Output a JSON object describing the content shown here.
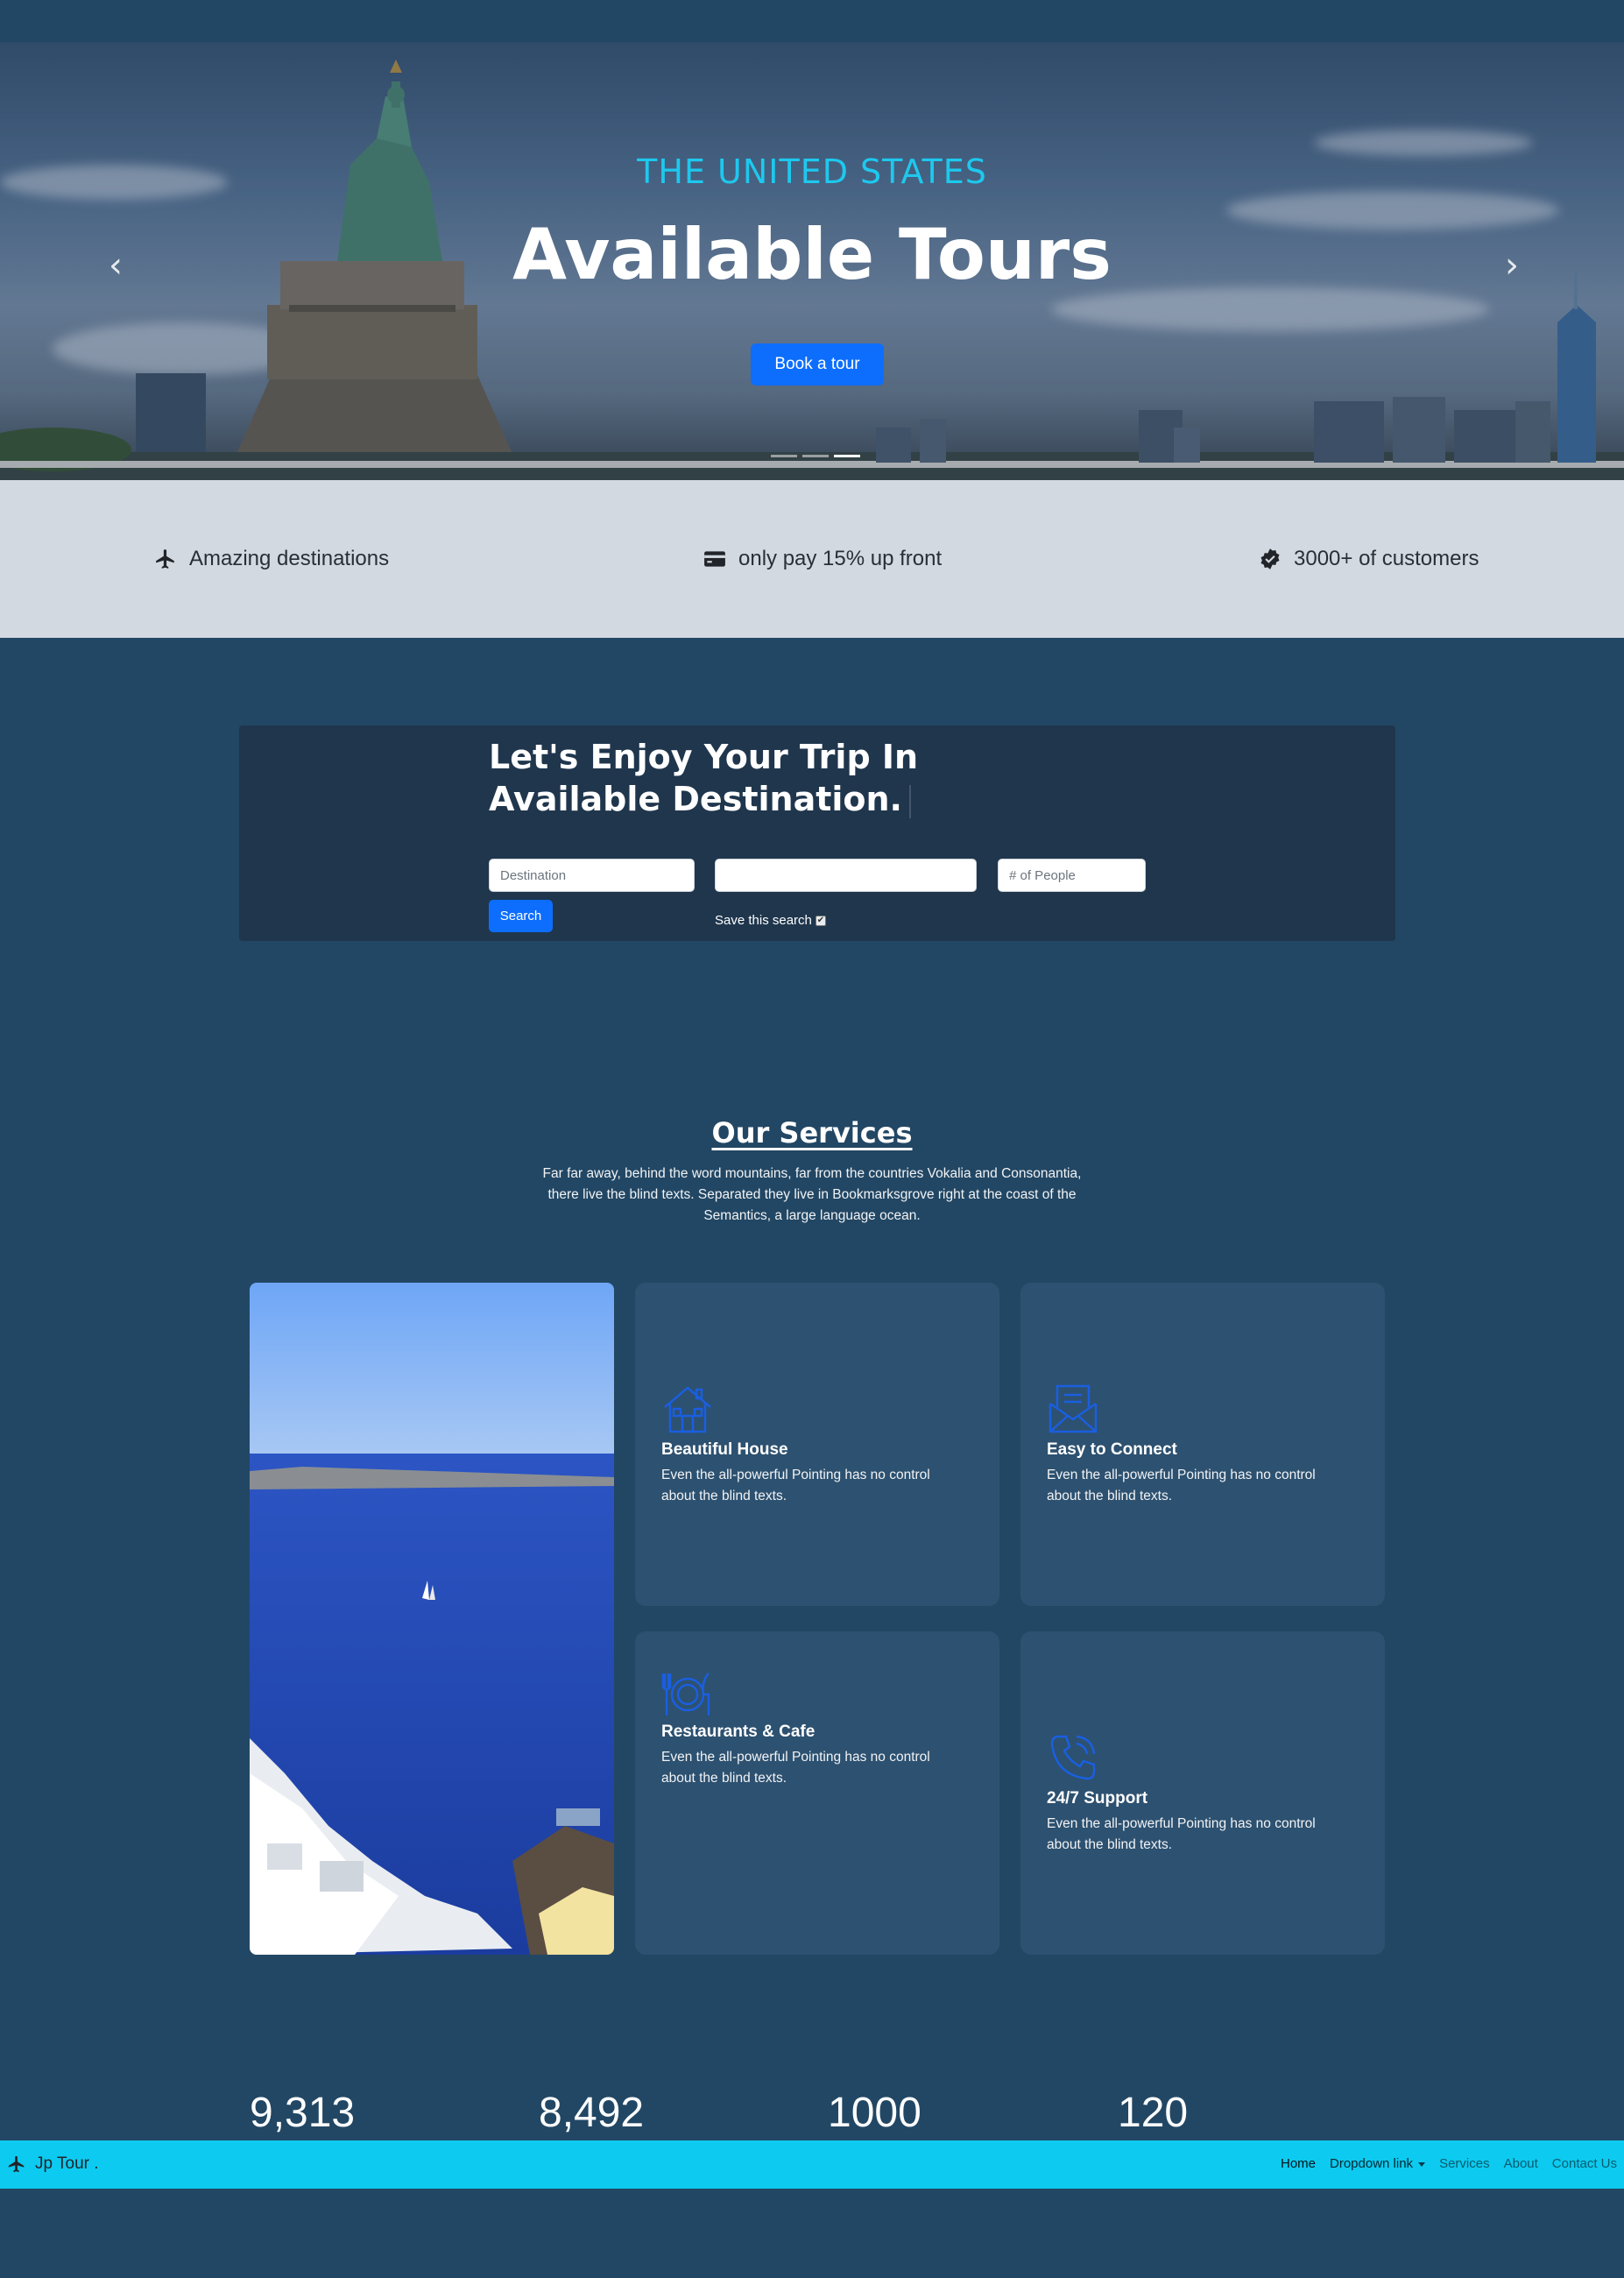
{
  "hero": {
    "subtitle": "THE UNITED STATES",
    "title": "Available Tours",
    "button_label": "Book a tour",
    "prev_icon": "chevron-left-icon",
    "next_icon": "chevron-right-icon",
    "slides": 3,
    "active_slide": 3
  },
  "features": [
    {
      "icon": "airplane-icon",
      "label": "Amazing destinations"
    },
    {
      "icon": "credit-card-icon",
      "label": "only pay 15% up front"
    },
    {
      "icon": "verified-badge-icon",
      "label": "3000+ of customers"
    }
  ],
  "search": {
    "heading_line1": "Let's Enjoy Your Trip In",
    "heading_line2": "Available Destination.",
    "destination_placeholder": "Destination",
    "date_value": "",
    "people_placeholder": "# of People",
    "search_label": "Search",
    "save_label": "Save this search",
    "save_checked": true
  },
  "services": {
    "title": "Our Services",
    "description": "Far far away, behind the word mountains, far from the countries Vokalia and Consonantia, there live the blind texts. Separated they live in Bookmarksgrove right at the coast of the Semantics, a large language ocean.",
    "cards": [
      {
        "icon": "house-icon",
        "title": "Beautiful House",
        "text": "Even the all-powerful Pointing has no control about the blind texts."
      },
      {
        "icon": "envelope-open-icon",
        "title": "Easy to Connect",
        "text": "Even the all-powerful Pointing has no control about the blind texts."
      },
      {
        "icon": "plate-cutlery-icon",
        "title": "Restaurants & Cafe",
        "text": "Even the all-powerful Pointing has no control about the blind texts."
      },
      {
        "icon": "phone-ringing-icon",
        "title": "24/7 Support",
        "text": "Even the all-powerful Pointing has no control about the blind texts."
      }
    ]
  },
  "counters": [
    "9,313",
    "8,492",
    "1000",
    "120"
  ],
  "navbar": {
    "brand": "Jp Tour .",
    "brand_icon": "airplane-icon",
    "links": [
      "Home",
      "Dropdown link",
      "Services",
      "About",
      "Contact Us"
    ],
    "active_link": "Home"
  },
  "colors": {
    "page_bg": "#224764",
    "accent_blue": "#0d6efd",
    "hero_subtitle": "#1ec8ee",
    "navbar_bg": "#0dcaf0",
    "card_bg": "#2d5170",
    "search_box_bg": "#1f364d",
    "feature_strip_bg": "#d3d9e1"
  }
}
